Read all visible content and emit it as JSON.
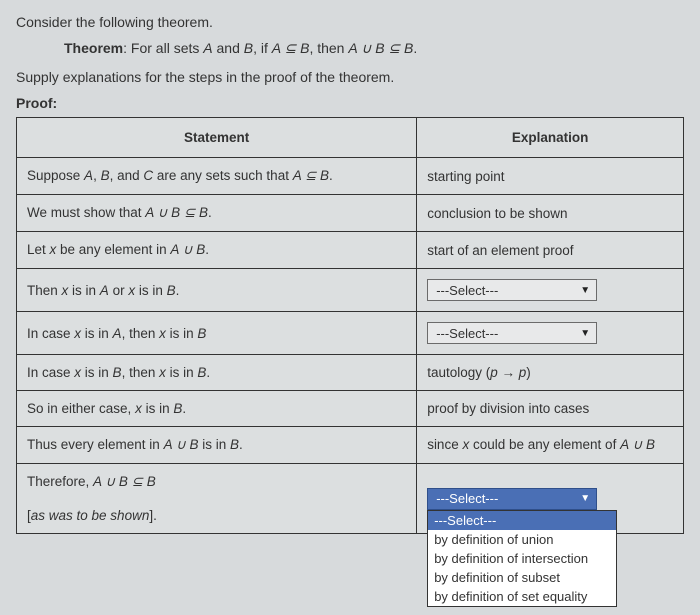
{
  "intro": "Consider the following theorem.",
  "theorem": {
    "label": "Theorem",
    "text_before": ": For all sets ",
    "A": "A",
    "and1": " and ",
    "B": "B",
    "cond": ", if ",
    "AsubB": "A ⊆ B",
    "then": ", then ",
    "AuBsubB": "A ∪ B ⊆ B",
    "period": "."
  },
  "supply": "Supply explanations for the steps in the proof of the theorem.",
  "proof_label": "Proof:",
  "headers": {
    "stmt": "Statement",
    "expl": "Explanation"
  },
  "rows": {
    "r1": {
      "s_before": "Suppose ",
      "s_A": "A",
      "s_c1": ", ",
      "s_B": "B",
      "s_c2": ", and ",
      "s_C": "C",
      "s_after1": " are any sets such that ",
      "s_cond": "A ⊆ B",
      "s_period": ".",
      "e": "starting point"
    },
    "r2": {
      "s_before": "We must show that ",
      "s_expr": "A ∪ B ⊆ B",
      "s_period": ".",
      "e": "conclusion to be shown"
    },
    "r3": {
      "s_before": "Let ",
      "s_x": "x",
      "s_mid": " be any element in ",
      "s_expr": "A ∪ B",
      "s_period": ".",
      "e": "start of an element proof"
    },
    "r4": {
      "s_before": "Then ",
      "s_x1": "x",
      "s_in1": " is in ",
      "s_A": "A",
      "s_or": " or ",
      "s_x2": "x",
      "s_in2": " is in ",
      "s_B": "B",
      "s_period": ".",
      "sel": "---Select---"
    },
    "r5": {
      "s_before": "In case ",
      "s_x1": "x",
      "s_in1": " is in ",
      "s_A": "A",
      "s_then": ", then ",
      "s_x2": "x",
      "s_in2": " is in ",
      "s_B": "B",
      "sel": "---Select---"
    },
    "r6": {
      "s_before": "In case ",
      "s_x1": "x",
      "s_in1": " is in ",
      "s_B1": "B",
      "s_then": ", then ",
      "s_x2": "x",
      "s_in2": " is in ",
      "s_B2": "B",
      "s_period": ".",
      "e_before": "tautology (",
      "e_p1": "p",
      "e_arrow": " → ",
      "e_p2": "p",
      "e_after": ")"
    },
    "r7": {
      "s_before": "So in either case, ",
      "s_x": "x",
      "s_in": " is in ",
      "s_B": "B",
      "s_period": ".",
      "e": "proof by division into cases"
    },
    "r8": {
      "s_before": "Thus every element in ",
      "s_expr": "A ∪ B",
      "s_in": " is in ",
      "s_B": "B",
      "s_period": ".",
      "e_before": "since ",
      "e_x": "x",
      "e_mid": " could be any element of ",
      "e_expr": "A ∪ B"
    },
    "r9a": {
      "s_before": "Therefore, ",
      "s_expr": "A ∪ B ⊆ B"
    },
    "r9b": {
      "s_before": "[",
      "s_it": "as was to be shown",
      "s_after": "]."
    },
    "r9sel": "---Select---",
    "r9opts": {
      "o0": "---Select---",
      "o1": "by definition of union",
      "o2": "by definition of intersection",
      "o3": "by definition of subset",
      "o4": "by definition of set equality"
    }
  },
  "caret": "▼"
}
